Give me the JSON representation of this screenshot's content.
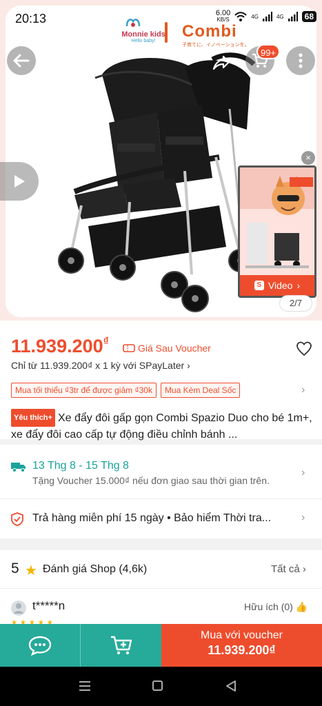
{
  "status": {
    "time": "20:13",
    "speed_value": "6.00",
    "speed_unit": "KB/S",
    "net1": "4G",
    "net2": "4G",
    "battery": "68"
  },
  "brands": {
    "monnie": "Monnie kids",
    "monnie_sub": "Hello baby!",
    "combi": "Combi",
    "combi_sub": "子育てに、イノベーションを。"
  },
  "header": {
    "cart_badge": "99+"
  },
  "gallery": {
    "counter": "2/7",
    "video_label": "Video",
    "video_close": "×"
  },
  "price": {
    "amount": "11.939.200",
    "currency": "₫",
    "voucher_tag": "Giá Sau Voucher",
    "spaylater": "Chỉ từ 11.939.200₫ x 1 kỳ với SPayLater",
    "chips": [
      "Mua tối thiểu ₫3tr để được giảm ₫30k",
      "Mua Kèm Deal Sốc"
    ],
    "favorite_badge": "Yêu thích+",
    "title": "Xe đẩy đôi gấp gọn Combi Spazio Duo cho bé 1m+, xe đẩy đôi cao cấp tự động điều chỉnh bánh ..."
  },
  "shipping": {
    "date": "13 Thg 8 - 15 Thg 8",
    "voucher": "Tặng Voucher 15.000₫ nếu đơn giao sau thời gian trên."
  },
  "returns": {
    "text": "Trả hàng miễn phí 15 ngày  •  Bảo hiểm Thời tra..."
  },
  "rating": {
    "score": "5",
    "title": "Đánh giá Shop",
    "count": "(4,6k)",
    "see_all": "Tất cả",
    "reviewer": "t*****n",
    "helpful": "Hữu ích (0)",
    "review_stars": "★★★★★"
  },
  "bottom": {
    "buy_line1": "Mua với voucher",
    "buy_line2": "11.939.200₫"
  },
  "colors": {
    "primary": "#ee4d2d",
    "teal": "#26aa99",
    "ship": "#1aa39a"
  }
}
